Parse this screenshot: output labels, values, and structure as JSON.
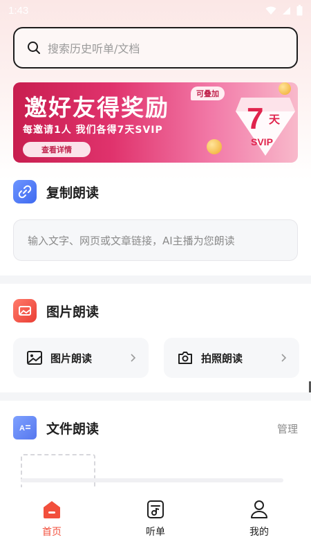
{
  "status_bar": {
    "time": "1:43"
  },
  "search": {
    "placeholder": "搜索历史听单/文档"
  },
  "banner": {
    "title": "邀好友得奖励",
    "subtitle": "每邀请1人 我们各得7天SVIP",
    "button_label": "查看详情",
    "tag": "可叠加",
    "badge_number": "7",
    "badge_unit": "天",
    "badge_text": "SVIP"
  },
  "copy_read": {
    "title": "复制朗读",
    "input_placeholder": "输入文字、网页或文章链接，AI主播为您朗读"
  },
  "image_read": {
    "title": "图片朗读",
    "cards": [
      {
        "label": "图片朗读",
        "icon": "image-icon"
      },
      {
        "label": "拍照朗读",
        "icon": "camera-icon"
      }
    ]
  },
  "file_read": {
    "title": "文件朗读",
    "manage_label": "管理"
  },
  "tabbar": {
    "tabs": [
      {
        "label": "首页",
        "icon": "home-icon",
        "active": true
      },
      {
        "label": "听单",
        "icon": "playlist-icon",
        "active": false
      },
      {
        "label": "我的",
        "icon": "profile-icon",
        "active": false
      }
    ]
  },
  "colors": {
    "accent": "#f24f3c",
    "banner_start": "#c81e4f",
    "banner_end": "#f8b9cb",
    "section_icon_blue": "#4f7bff",
    "section_icon_red": "#f0594a"
  }
}
